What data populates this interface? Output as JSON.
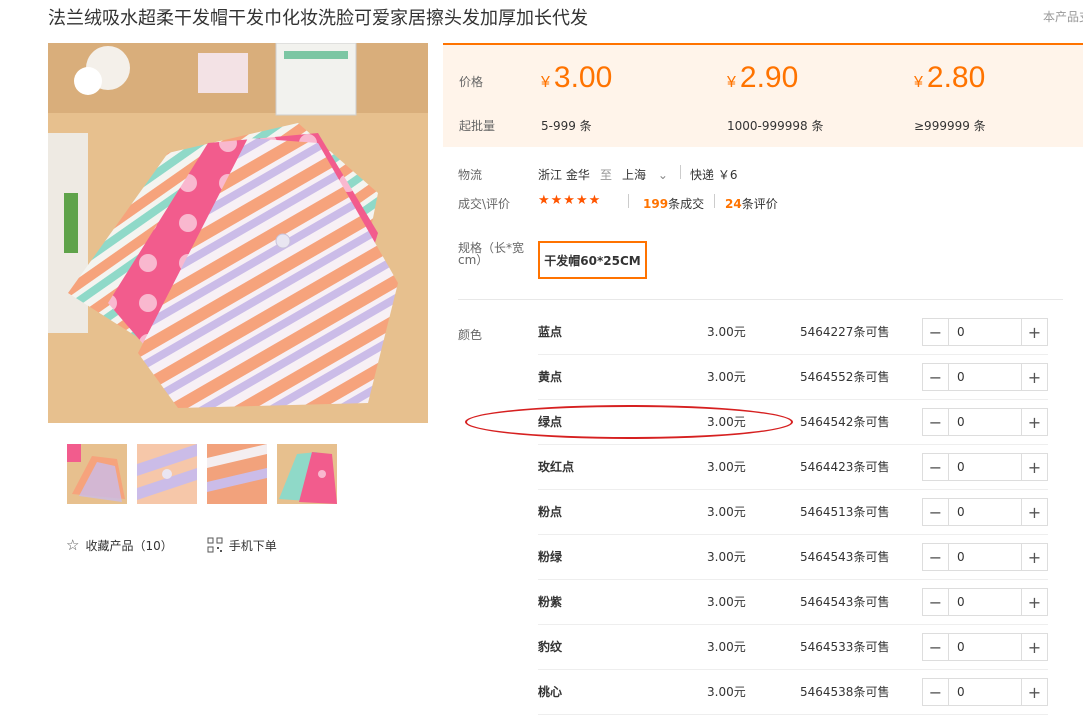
{
  "product": {
    "title": "法兰绒吸水超柔干发帽干发巾化妆洗脸可爱家居擦头发加厚加长代发",
    "top_right_note": "本产品支"
  },
  "gallery": {
    "main_image": "towel-caps-photo",
    "thumbnails": [
      "thumb-1",
      "thumb-2",
      "thumb-3",
      "thumb-4"
    ]
  },
  "actions": {
    "favorite_label": "收藏产品（10）",
    "favorite_icon": "star-outline-icon",
    "mobile_label": "手机下单",
    "mobile_icon": "qr-code-icon"
  },
  "price_box": {
    "price_label": "价格",
    "moq_label": "起批量",
    "currency": "¥",
    "accent_color": "#ff7300",
    "tiers": [
      {
        "price": "3.00",
        "qty": "5-999 条"
      },
      {
        "price": "2.90",
        "qty": "1000-999998 条"
      },
      {
        "price": "2.80",
        "qty": "≥999999 条"
      }
    ]
  },
  "logistics": {
    "label": "物流",
    "origin": "浙江 金华",
    "to": "至",
    "destination": "上海",
    "shipping": "快递 ￥6"
  },
  "rating": {
    "label": "成交\\评价",
    "stars": "★★★★★",
    "deals_num": "199",
    "deals_text": "条成交",
    "reviews_num": "24",
    "reviews_text": "条评价"
  },
  "spec": {
    "label": "规格（长*宽cm）",
    "selected": "干发帽60*25CM"
  },
  "colors": {
    "label": "颜色",
    "rows": [
      {
        "name": "蓝点",
        "price": "3.00元",
        "stock": "5464227条可售",
        "qty": "0"
      },
      {
        "name": "黄点",
        "price": "3.00元",
        "stock": "5464552条可售",
        "qty": "0"
      },
      {
        "name": "绿点",
        "price": "3.00元",
        "stock": "5464542条可售",
        "qty": "0"
      },
      {
        "name": "玫红点",
        "price": "3.00元",
        "stock": "5464423条可售",
        "qty": "0"
      },
      {
        "name": "粉点",
        "price": "3.00元",
        "stock": "5464513条可售",
        "qty": "0"
      },
      {
        "name": "粉绿",
        "price": "3.00元",
        "stock": "5464543条可售",
        "qty": "0"
      },
      {
        "name": "粉紫",
        "price": "3.00元",
        "stock": "5464543条可售",
        "qty": "0"
      },
      {
        "name": "豹纹",
        "price": "3.00元",
        "stock": "5464533条可售",
        "qty": "0"
      },
      {
        "name": "桃心",
        "price": "3.00元",
        "stock": "5464538条可售",
        "qty": "0"
      }
    ]
  }
}
